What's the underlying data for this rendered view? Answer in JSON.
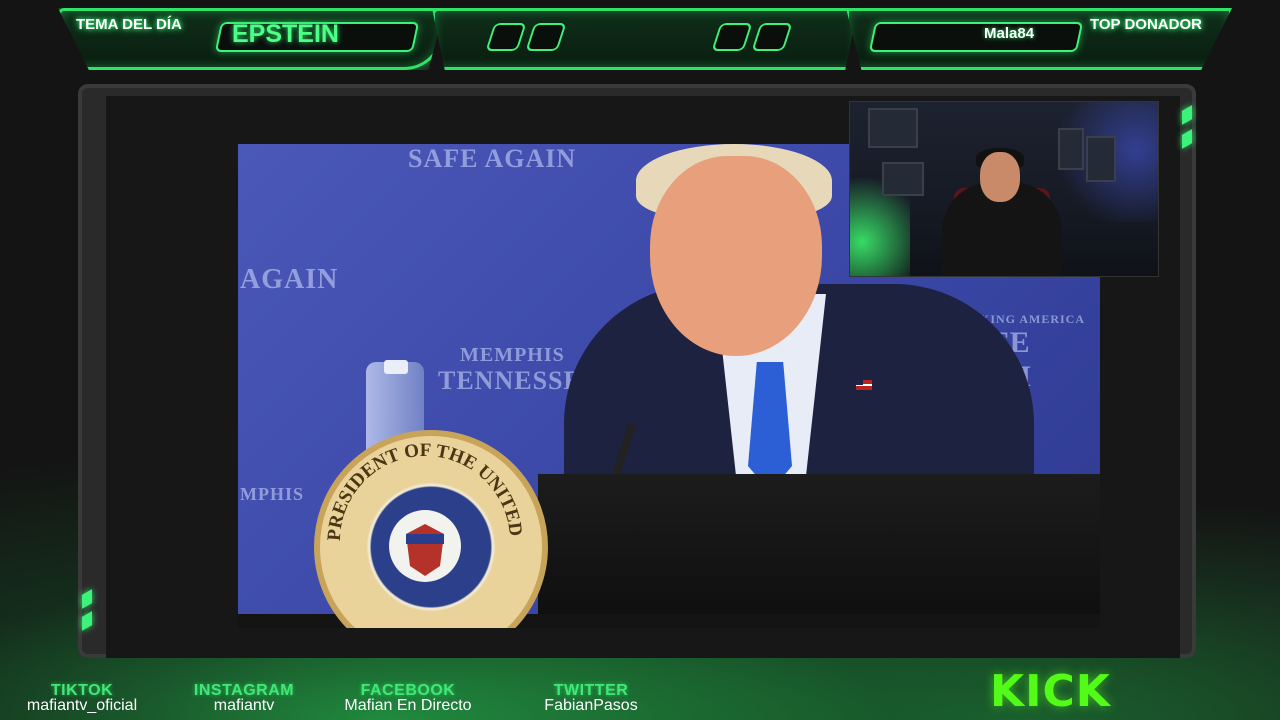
{
  "header": {
    "topic_label": "TEMA DEL DÍA",
    "topic_value": "EPSTEIN",
    "top_donor_label": "TOP DONADOR",
    "top_donor_value": "Mala84"
  },
  "photo": {
    "backdrop_texts": [
      "SAFE AGAIN",
      "AGAIN",
      "MEMPHIS",
      "TENNESSEE",
      "MAKING AMERICA",
      "SAFE AGAI",
      "MPHIS"
    ],
    "seal_text": "PRESIDENT OF THE UNITED STATES"
  },
  "socials": [
    {
      "label": "TIKTOK",
      "handle": "mafiantv_oficial"
    },
    {
      "label": "INSTAGRAM",
      "handle": "mafiantv"
    },
    {
      "label": "FACEBOOK",
      "handle": "Mafian En Directo"
    },
    {
      "label": "TWITTER",
      "handle": "FabianPasos"
    }
  ],
  "brand": {
    "platform_logo": "KICK"
  },
  "colors": {
    "accent": "#2fe36a",
    "kick": "#53fc18",
    "background": "#141414"
  }
}
